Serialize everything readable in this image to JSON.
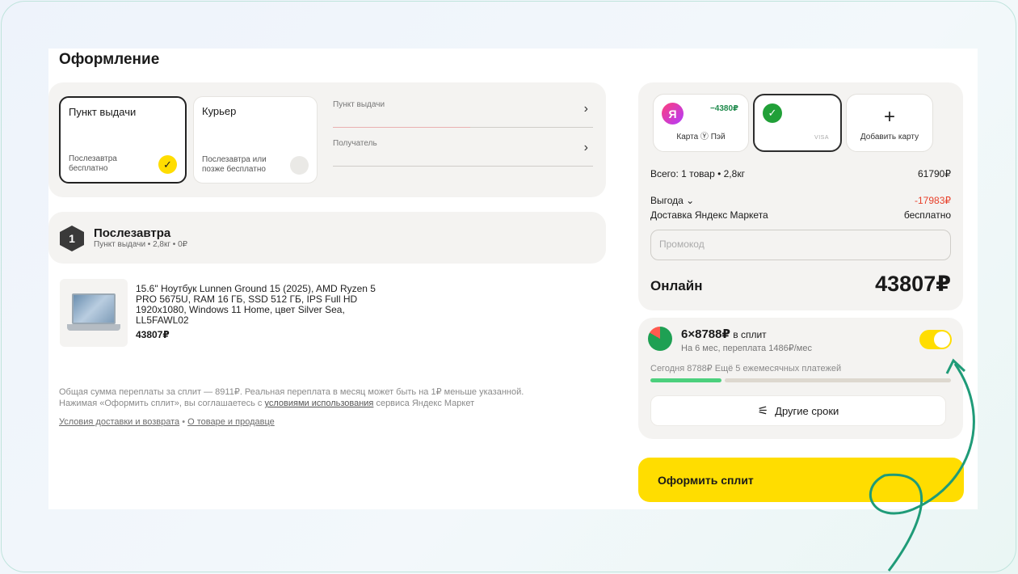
{
  "page": {
    "title": "Оформление"
  },
  "delivery": {
    "pickup": {
      "title": "Пункт выдачи",
      "sub": "Послезавтра бесплатно"
    },
    "courier": {
      "title": "Курьер",
      "sub": "Послезавтра или позже бесплатно"
    },
    "pickup_field_label": "Пункт выдачи",
    "recipient_field_label": "Получатель"
  },
  "shipment": {
    "number": "1",
    "title": "Послезавтра",
    "sub": "Пункт выдачи • 2,8кг • 0₽"
  },
  "product": {
    "name": "15.6\" Ноутбук Lunnen Ground 15 (2025), AMD Ryzen 5 PRO 5675U, RAM 16 ГБ, SSD 512 ГБ, IPS Full HD 1920x1080, Windows 11 Home, цвет Silver Sea, LL5FAWL02",
    "price": "43807₽"
  },
  "note": {
    "text1": "Общая сумма переплаты за сплит — 8911₽. Реальная переплата в месяц может быть на 1₽ меньше указанной.",
    "text2_pre": "Нажимая «Оформить сплит», вы соглашаетесь с ",
    "text2_link": "условиями использования",
    "text2_post": " сервиса Яндекс Маркет",
    "link_delivery": "Условия доставки и возврата",
    "link_sep": " • ",
    "link_product": "О товаре и продавце"
  },
  "payment": {
    "yandex": {
      "logo": "Я",
      "bonus": "−4380₽",
      "label": "Карта Ⓨ Пэй"
    },
    "visa": {
      "logo": "✓",
      "brand": "VISA"
    },
    "add": {
      "icon": "+",
      "label": "Добавить карту"
    }
  },
  "summary": {
    "total_label": "Всего: 1 товар • 2,8кг",
    "total_value": "61790₽",
    "benefit_label": "Выгода ⌄",
    "benefit_value": "-17983₽",
    "delivery_label": "Доставка Яндекс Маркета",
    "delivery_value": "бесплатно",
    "promo_placeholder": "Промокод",
    "online_label": "Онлайн",
    "online_total": "43807₽"
  },
  "split": {
    "title_main": "6×8788₽",
    "title_suffix": " в сплит",
    "sub": "На 6 мес, переплата 1486₽/мес",
    "today": "Сегодня 8788₽   Ещё 5 ежемесячных платежей",
    "other_terms": "Другие сроки",
    "enabled": true
  },
  "checkout_button": "Оформить сплит",
  "colors": {
    "accent": "#ffdd00",
    "annotation": "#1f9b78"
  }
}
